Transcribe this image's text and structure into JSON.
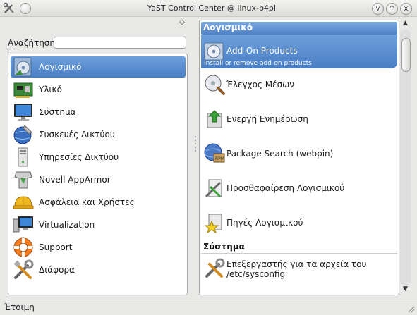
{
  "window": {
    "title": "YaST Control Center @ linux-b4pi",
    "minimize_glyph": "v",
    "maximize_glyph": "^",
    "close_glyph": "x",
    "pin_glyph": "◇"
  },
  "search": {
    "label_first": "Α",
    "label_rest": "ναζήτηση",
    "value": "",
    "placeholder": ""
  },
  "categories": [
    {
      "label": "Λογισμικό",
      "icon": "software-cd-icon",
      "selected": true
    },
    {
      "label": "Υλικό",
      "icon": "hardware-board-icon"
    },
    {
      "label": "Σύστημα",
      "icon": "system-monitor-icon"
    },
    {
      "label": "Συσκευές Δικτύου",
      "icon": "network-devices-icon"
    },
    {
      "label": "Υπηρεσίες Δικτύου",
      "icon": "network-services-icon"
    },
    {
      "label": "Novell AppArmor",
      "icon": "apparmor-icon"
    },
    {
      "label": "Ασφάλεια και Χρήστες",
      "icon": "security-helmet-icon"
    },
    {
      "label": "Virtualization",
      "icon": "virtualization-icon"
    },
    {
      "label": "Support",
      "icon": "support-lifebuoy-icon"
    },
    {
      "label": "Διάφορα",
      "icon": "misc-tools-icon"
    }
  ],
  "right": {
    "section1": "Λογισμικό",
    "modules": [
      {
        "label": "Add-On Products",
        "description": "Install or remove add-on products",
        "icon": "addon-products-icon",
        "selected": true
      },
      {
        "label": "Έλεγχος Μέσων",
        "icon": "media-check-icon"
      },
      {
        "label": "Ενεργή Ενημέρωση",
        "icon": "online-update-icon"
      },
      {
        "label": "Package Search (webpin)",
        "icon": "package-search-icon"
      },
      {
        "label": "Προσθαφαίρεση Λογισμικού",
        "icon": "software-management-icon"
      },
      {
        "label": "Πηγές Λογισμικού",
        "icon": "software-repositories-icon"
      }
    ],
    "section2": "Σύστημα",
    "system_module": {
      "label": "Επεξεργαστής για τα αρχεία του /etc/sysconfig",
      "icon": "sysconfig-editor-icon"
    }
  },
  "scrollbar": {
    "up_glyph": "▲",
    "down_glyph": "▼"
  },
  "status": {
    "text": "Έτοιμη"
  },
  "colors": {
    "selection": "#5b8fd2",
    "window_bg": "#e8e8e6"
  }
}
